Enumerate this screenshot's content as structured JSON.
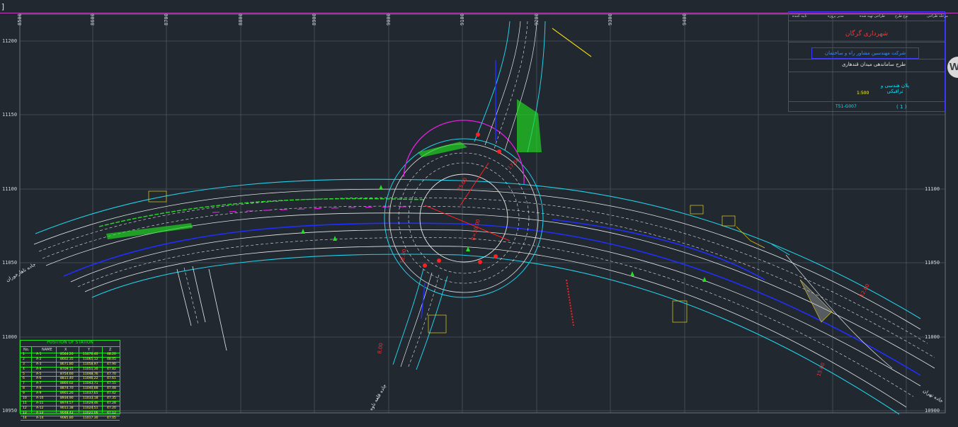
{
  "window": {
    "bracket": "]"
  },
  "grid": {
    "x_ticks": [
      "8500",
      "8600",
      "8700",
      "8800",
      "8900",
      "9000",
      "9100",
      "9200",
      "9300",
      "9400"
    ],
    "y_ticks": [
      "11200",
      "11150",
      "11100",
      "11050",
      "11000",
      "10950",
      "10900"
    ]
  },
  "title_block": {
    "header_labels": [
      "مرحله طراحی",
      "نوع طرح",
      "طراحی تهیه شده",
      "مدیر پروژه",
      "تایید کننده"
    ],
    "client": "شهرداری گرگان",
    "consultant": "شرکت مهندسین مشاور راه و ساختمان",
    "project": "طرح ساماندهی میدان قندهاری",
    "sheet_title": "پلان هندسی و ترافیکی",
    "scale": "1:500",
    "code": "T51-G007",
    "sheet_no": "( 1 )"
  },
  "station_table": {
    "title": "POSITION OF STATION",
    "headers": [
      "No.",
      "NAME",
      "X",
      "Y",
      "Z"
    ],
    "rows": [
      [
        "1",
        "A-1",
        "8564.20",
        "11076.40",
        "48.20"
      ],
      [
        "2",
        "A-2",
        "8602.35",
        "11065.12",
        "48.05"
      ],
      [
        "3",
        "A-3",
        "8671.80",
        "11058.97",
        "47.90"
      ],
      [
        "4",
        "A-4",
        "8709.15",
        "11051.30",
        "47.82"
      ],
      [
        "5",
        "A-5",
        "8754.60",
        "11048.76",
        "47.70"
      ],
      [
        "6",
        "A-6",
        "8811.40",
        "11046.22",
        "47.61"
      ],
      [
        "7",
        "A-7",
        "8860.02",
        "11043.71",
        "47.55"
      ],
      [
        "8",
        "A-8",
        "8874.70",
        "11040.88",
        "47.48"
      ],
      [
        "9",
        "A-9",
        "8901.26",
        "11037.65",
        "47.42"
      ],
      [
        "10",
        "A-10",
        "8934.90",
        "11033.18",
        "47.35"
      ],
      [
        "11",
        "A-11",
        "8974.57",
        "11029.46",
        "47.28"
      ],
      [
        "12",
        "A-12",
        "9011.38",
        "11024.51",
        "47.20"
      ],
      [
        "13",
        "A-13",
        "9048.42",
        "11021.06",
        "47.12"
      ],
      [
        "14",
        "A-14",
        "9085.80",
        "11017.30",
        "47.05"
      ]
    ]
  },
  "labels": {
    "dims": [
      "25.00",
      "R=30.00",
      "12.00",
      "12.00",
      "15.00",
      "8.00",
      "17.50"
    ],
    "road_west": "جاده ناهارخوران",
    "road_south": "جاده قلعه ناوه",
    "road_east": "جاده تهران"
  },
  "colors": {
    "background": "#212830",
    "grid": "#4a5560",
    "road_white": "#e8e8e8",
    "road_cyan": "#22d0e8",
    "median_blue": "#1f2fff",
    "green": "#22e022",
    "yellow": "#e8d11c",
    "red": "#ff2020",
    "magenta": "#e020e0"
  },
  "watermark": {
    "letter": "W",
    "icon": "watermark-logo-icon"
  }
}
